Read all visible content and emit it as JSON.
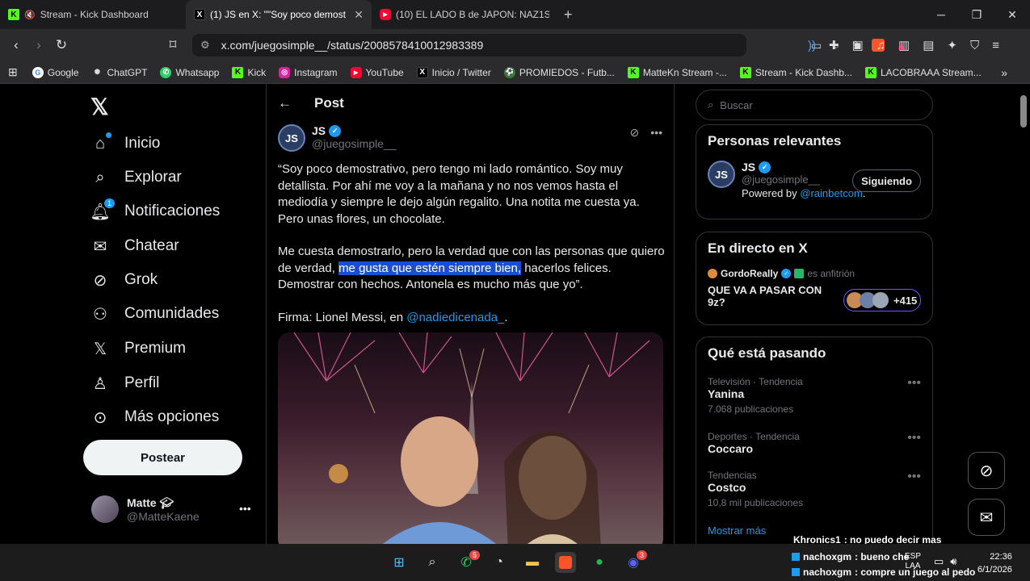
{
  "tabs": [
    {
      "label": "Stream - Kick Dashboard",
      "icon": "kick-icon"
    },
    {
      "label": "(1) JS en X: \"\"Soy poco demostra",
      "icon": "x-icon"
    },
    {
      "label": "(10) EL LADO B de JAPON: NAZ1SMO",
      "icon": "youtube-icon"
    }
  ],
  "url": "x.com/juegosimple__/status/2008578410012983389",
  "bookmarks": [
    "Google",
    "ChatGPT",
    "Whatsapp",
    "Kick",
    "Instagram",
    "YouTube",
    "Inicio / Twitter",
    "PROMIEDOS - Futb...",
    "MatteKn Stream -...",
    "Stream - Kick Dashb...",
    "LACOBRAAA Stream..."
  ],
  "nav": {
    "home": "Inicio",
    "explore": "Explorar",
    "notifications": "Notificaciones",
    "notif_count": "1",
    "chat": "Chatear",
    "grok": "Grok",
    "communities": "Comunidades",
    "premium": "Premium",
    "profile": "Perfil",
    "more": "Más opciones",
    "post_button": "Postear"
  },
  "me": {
    "name": "Matte",
    "handle": "@MatteKaene"
  },
  "post": {
    "header": "Post",
    "author": "JS",
    "handle": "@juegosimple__",
    "p1": "“Soy poco demostrativo, pero tengo mi lado romántico. Soy muy detallista. Por ahí me voy a la mañana y no nos vemos hasta el mediodía y siempre le dejo algún regalito. Una notita me cuesta ya. Pero unas flores, un chocolate.",
    "p2_a": "Me cuesta demostrarlo, pero la verdad que con las personas que quiero de verdad, ",
    "p2_hl": "me gusta que estén siempre bien,",
    "p2_b": " hacerlos felices. Demostrar con hechos. Antonela es mucho más que yo”.",
    "p3_a": "Firma: Lionel Messi, en ",
    "p3_link": "@nadiedicenada_",
    "p3_b": "."
  },
  "right": {
    "search_placeholder": "Buscar",
    "relevant_title": "Personas relevantes",
    "rel_name": "JS",
    "rel_handle": "@juegosimple__",
    "follow_label": "Siguiendo",
    "powered": "Powered by ",
    "powered_link": "@rainbetcom",
    "powered_end": ".",
    "live_title": "En directo en X",
    "live_host": "GordoReally",
    "live_role": "es anfitrión",
    "live_topic": "QUE VA A PASAR CON 9z?",
    "live_count": "+415",
    "trending_title": "Qué está pasando",
    "trends": [
      {
        "cat": "Televisión · Tendencia",
        "title": "Yanina",
        "count": "7.068 publicaciones"
      },
      {
        "cat": "Deportes · Tendencia",
        "title": "Coccaro",
        "count": ""
      },
      {
        "cat": "Tendencias",
        "title": "Costco",
        "count": "10,8 mil publicaciones"
      }
    ],
    "show_more": "Mostrar más"
  },
  "overlay_chat": [
    {
      "user": "Khronics1",
      "msg": ": no puedo decir mas"
    },
    {
      "user": "nachoxgm",
      "msg": ": bueno che"
    },
    {
      "user": "nachoxgm",
      "msg": ": compre un juego al pedo"
    }
  ],
  "taskbar": {
    "lang": "ESP",
    "lang2": "LAA",
    "time": "22:36",
    "date": "6/1/2026",
    "whatsapp_badge": "5",
    "discord_badge": "3"
  }
}
